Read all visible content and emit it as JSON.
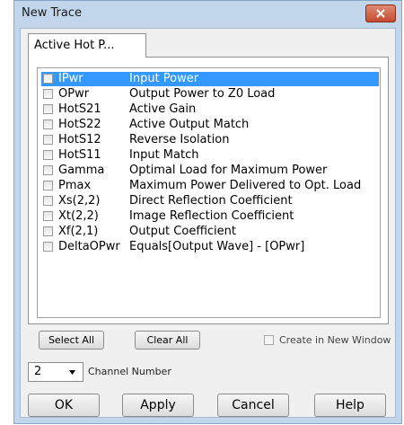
{
  "window": {
    "title": "New Trace"
  },
  "tab": {
    "label": "Active Hot P..."
  },
  "traces": [
    {
      "name": "IPwr",
      "description": "Input Power",
      "checked": false,
      "selected": true
    },
    {
      "name": "OPwr",
      "description": "Output Power to Z0 Load",
      "checked": false
    },
    {
      "name": "HotS21",
      "description": "Active Gain",
      "checked": false
    },
    {
      "name": "HotS22",
      "description": "Active Output Match",
      "checked": false
    },
    {
      "name": "HotS12",
      "description": "Reverse Isolation",
      "checked": false
    },
    {
      "name": "HotS11",
      "description": "Input Match",
      "checked": false
    },
    {
      "name": "Gamma",
      "description": "Optimal Load for Maximum Power",
      "checked": false
    },
    {
      "name": "Pmax",
      "description": "Maximum Power Delivered to Opt. Load",
      "checked": false
    },
    {
      "name": "Xs(2,2)",
      "description": "Direct Reflection Coefficient",
      "checked": false
    },
    {
      "name": "Xt(2,2)",
      "description": "Image Reflection Coefficient",
      "checked": false
    },
    {
      "name": "Xf(2,1)",
      "description": "Output Coefficient",
      "checked": false
    },
    {
      "name": "DeltaOPwr",
      "description": "Equals[Output Wave] - [OPwr]",
      "checked": false
    }
  ],
  "buttons": {
    "select_all": "Select All",
    "clear_all": "Clear All",
    "ok": "OK",
    "apply": "Apply",
    "cancel": "Cancel",
    "help": "Help"
  },
  "create_new_window": {
    "label": "Create in New Window",
    "checked": false
  },
  "channel": {
    "value": "2",
    "label": "Channel Number"
  },
  "colors": {
    "selection": "#3399ff",
    "frame": "#c1d5eb",
    "close": "#c24a30"
  }
}
